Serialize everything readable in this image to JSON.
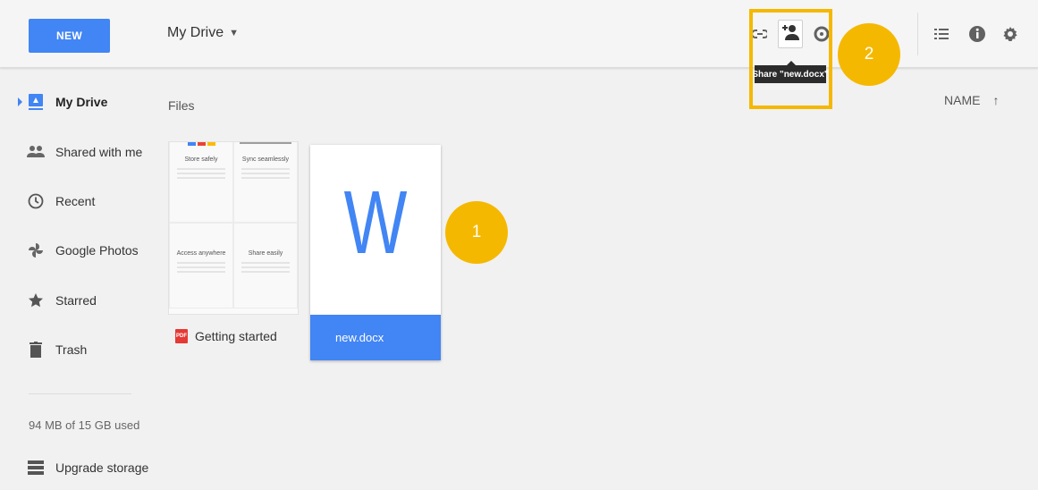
{
  "toolbar": {
    "new_label": "NEW",
    "title": "My Drive",
    "caret": "▼",
    "share_tooltip": "Share \"new.docx\"",
    "icons": [
      "link-icon",
      "add-person-icon",
      "preview-icon",
      "list-view-icon",
      "info-icon",
      "gear-icon"
    ]
  },
  "annotations": {
    "badge_1": "1",
    "badge_2": "2",
    "highlight_color": "#f5b800"
  },
  "sidebar": {
    "items": [
      {
        "label": "My Drive",
        "icon": "drive-icon"
      },
      {
        "label": "Shared with me",
        "icon": "people-icon"
      },
      {
        "label": "Recent",
        "icon": "clock-icon"
      },
      {
        "label": "Google Photos",
        "icon": "pinwheel-icon"
      },
      {
        "label": "Starred",
        "icon": "star-icon"
      },
      {
        "label": "Trash",
        "icon": "trash-icon"
      }
    ],
    "storage": "94 MB of 15 GB used",
    "upgrade": "Upgrade storage"
  },
  "main": {
    "section_label": "Files",
    "sort_label": "NAME",
    "sort_arrow": "↑",
    "files": [
      {
        "name": "Getting started",
        "type_badge": "PDF",
        "thumb": {
          "store_title": "Store safely",
          "sync_title": "Sync seamlessly",
          "access_title": "Access anywhere",
          "share_title": "Share easily"
        }
      },
      {
        "name": "new.docx",
        "doc_letter": "W"
      }
    ]
  },
  "colors": {
    "accent": "#4285f4",
    "highlight": "#f5b800",
    "pdf": "#e53935"
  }
}
